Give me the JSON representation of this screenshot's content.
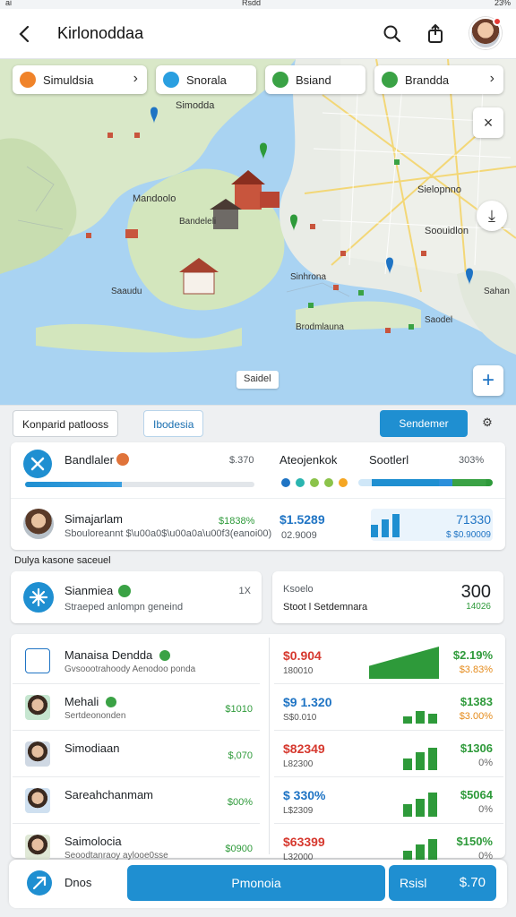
{
  "status": {
    "left": "ai",
    "center": "Rsdd",
    "right": "23%"
  },
  "header": {
    "title": "Kirlonoddaa",
    "icons": [
      "back-arrow-icon",
      "search-icon",
      "share-icon",
      "avatar"
    ]
  },
  "map": {
    "chips": [
      {
        "label": "Simuldsia",
        "icon": "heart-icon",
        "color": "#f0832a"
      },
      {
        "label": "Snorala",
        "icon": "check-icon",
        "color": "#2a9fe0"
      },
      {
        "label": "Bsiand",
        "icon": "leaf-icon",
        "color": "#3aa245"
      },
      {
        "label": "Brandda",
        "icon": "pin-icon",
        "color": "#3aa245"
      }
    ],
    "place_labels": [
      "Simodda",
      "Mandoolo",
      "Bandeleli",
      "Sielopnno",
      "Soouidlon",
      "Sinhrona",
      "Saaudu",
      "Brodmlauna",
      "Saodel",
      "Sahan"
    ],
    "scale_label": "Saidel",
    "buttons": {
      "close": "×",
      "add": "+",
      "compass": "⤓"
    }
  },
  "panel": {
    "tabs": [
      {
        "label": "Konparid patlooss"
      },
      {
        "label": "Ibodesia"
      }
    ],
    "primary_button": "Sendemer",
    "settings_icon": "gear-icon",
    "progress_card": {
      "name": "Bandlaler",
      "value": "$.370",
      "progress": 0.42,
      "col2_title": "Ateojenkok",
      "col3_title": "Sootlerl",
      "col3_value": "303%",
      "dots": [
        "#1f74c4",
        "#2bb5b0",
        "#8bc34a",
        "#8bc34a",
        "#f5a623"
      ]
    },
    "person_card": {
      "name": "Simajarlam",
      "sub": "Sbouloreannt $\\u00a0$\\u00a0a\\u00f3(eanoi00)",
      "pct": "$1838%",
      "amount": "$1.5289",
      "amount_sub": "02.9009",
      "right_value": "71330",
      "right_sub": "$ $0.90009"
    },
    "section_label": "Dulya kasone saceuel",
    "summary_left": {
      "name": "Sianmiea",
      "sub": "Straeped anlompn geneind",
      "count": "1X"
    },
    "summary_right": {
      "label": "Ksoelo",
      "value": "300",
      "sub": "Stoot l Setdemnara",
      "pct": "14026"
    },
    "list": [
      {
        "name": "Manaisa Dendda",
        "sub": "Gvsoootrahoody Aenodoo ponda",
        "val": "",
        "badge": true
      },
      {
        "name": "Mehali",
        "sub": "Sertdeononden",
        "val": "$1010",
        "badge": true
      },
      {
        "name": "Simodiaan",
        "sub": "",
        "val": "$,070",
        "badge": false
      },
      {
        "name": "Sareahchanmam",
        "sub": "",
        "val": "$00%",
        "badge": false
      },
      {
        "name": "Saimolocia",
        "sub": "Seoodtanraoy aylooe0sse",
        "val": "$0900",
        "badge": false
      }
    ],
    "stats": [
      {
        "a": "$0.904",
        "a_color": "red",
        "b": "180010",
        "c": "$2.19%",
        "d": "$3.83%",
        "d_color": "orange",
        "bars": [
          0.4,
          0.7,
          1.0
        ]
      },
      {
        "a": "$9 1.320",
        "a_color": "blue",
        "b": "S$0.010",
        "c": "$1383",
        "d": "$3.00%",
        "d_color": "orange",
        "bars": [
          0.3,
          0.5,
          0.4
        ]
      },
      {
        "a": "$82349",
        "a_color": "red",
        "b": "L82300",
        "c": "$1306",
        "d": "0%",
        "d_color": "gray",
        "bars": [
          0.45,
          0.7,
          0.9
        ]
      },
      {
        "a": "$ 330%",
        "a_color": "blue",
        "b": "L$2309",
        "c": "$5064",
        "d": "0%",
        "d_color": "gray",
        "bars": [
          0.5,
          0.7,
          0.95
        ]
      },
      {
        "a": "$63399",
        "a_color": "red",
        "b": "L32000",
        "c": "$150%",
        "d": "0%",
        "d_color": "gray",
        "bars": [
          0.5,
          0.75,
          0.95
        ]
      }
    ],
    "bottom": {
      "left_label": "Dnos",
      "main_button": "Pmonoia",
      "right_button_label": "Rsisl",
      "right_button_value": "$.70"
    }
  }
}
